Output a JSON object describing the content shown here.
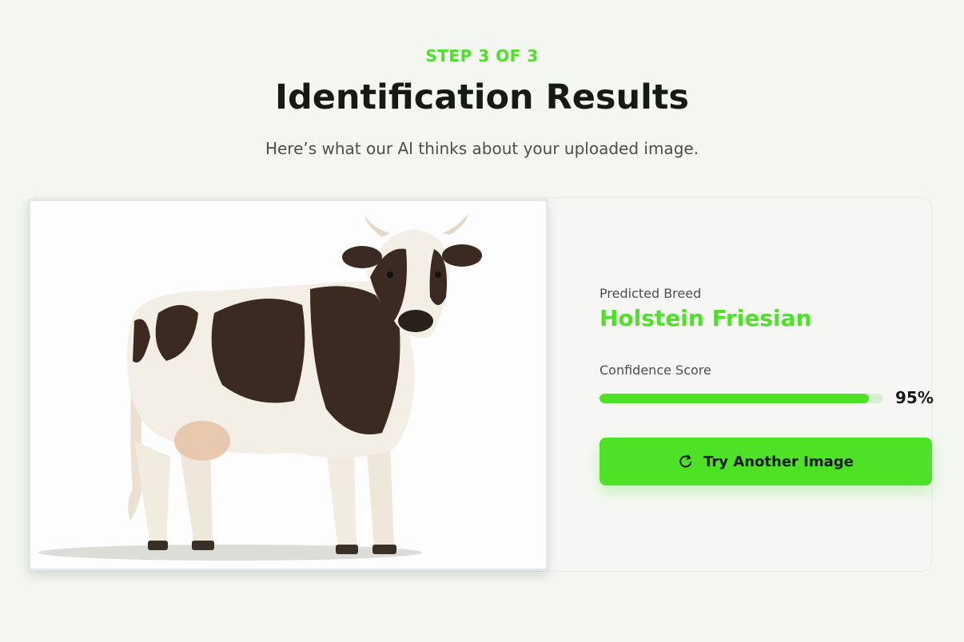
{
  "header": {
    "step": "STEP 3 OF 3",
    "title": "Identification Results",
    "subtitle": "Here’s what our AI thinks about your uploaded image."
  },
  "result": {
    "image_alt": "Uploaded image of a black and white cow",
    "breed_label": "Predicted Breed",
    "breed_value": "Holstein Friesian",
    "confidence_label": "Confidence Score",
    "confidence_percent": 95,
    "confidence_text": "95%"
  },
  "actions": {
    "try_again_label": "Try Another Image",
    "try_again_icon": "refresh-icon"
  },
  "colors": {
    "accent": "#4ee227",
    "text_dark": "#151a14",
    "text_muted": "#4b5049",
    "background": "#f4f6f2"
  }
}
